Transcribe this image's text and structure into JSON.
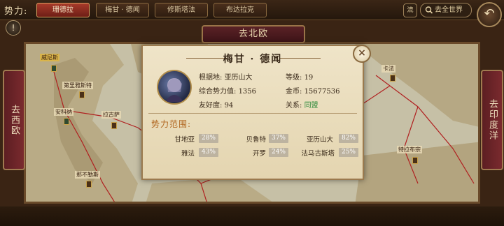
{
  "topbar": {
    "faction_label": "势力:",
    "tabs": [
      "珊德拉",
      "梅甘 · 德闻",
      "修斯塔法",
      "布达拉克"
    ],
    "flow_label": "流",
    "world_label": "去全世界"
  },
  "nav": {
    "north": "去北欧",
    "west": "去西欧",
    "east": "去印度洋"
  },
  "map": {
    "cities": [
      "威尼斯",
      "第里雅斯特",
      "安科纳",
      "拉古萨",
      "那不勒斯",
      "卡法",
      "特拉布宗"
    ]
  },
  "dialog": {
    "title": "梅甘 · 德闻",
    "base_label": "根据地:",
    "base_value": "亚历山大",
    "level_label": "等级:",
    "level_value": "19",
    "power_label": "综合势力值:",
    "power_value": "1356",
    "gold_label": "金币:",
    "gold_value": "15677536",
    "friend_label": "友好度:",
    "friend_value": "94",
    "relation_label": "关系:",
    "relation_value": "同盟",
    "section_title": "势力范围:",
    "territories": [
      {
        "name": "甘地亚",
        "pct": "28%"
      },
      {
        "name": "贝鲁特",
        "pct": "37%"
      },
      {
        "name": "亚历山大",
        "pct": "82%"
      },
      {
        "name": "雅法",
        "pct": "43%"
      },
      {
        "name": "开罗",
        "pct": "24%"
      },
      {
        "name": "法马古斯塔",
        "pct": "25%"
      }
    ]
  },
  "colors": {
    "active_tab": "#a83a2a",
    "relation_ally": "#2e8a3a",
    "section_title": "#b0651e"
  }
}
